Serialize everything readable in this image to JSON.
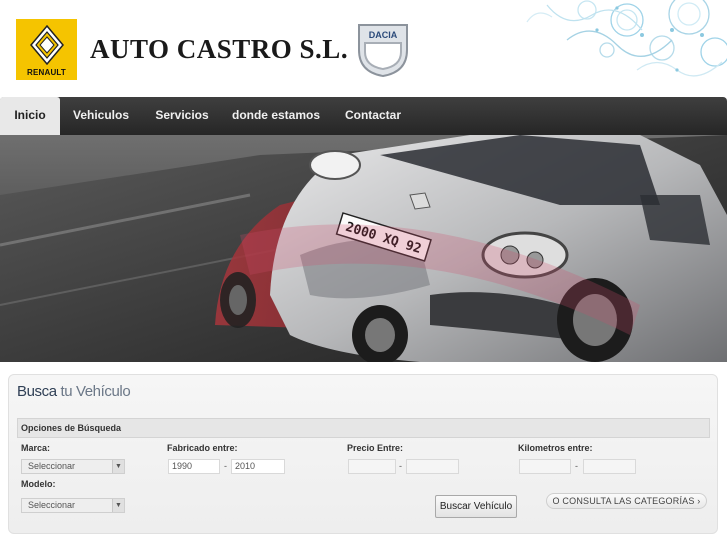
{
  "header": {
    "brand_left": "RENAULT",
    "site_title": "AUTO CASTRO S.L.",
    "brand_right": "DACIA"
  },
  "nav": {
    "items": [
      {
        "label": "Inicio",
        "active": true
      },
      {
        "label": "Vehiculos",
        "active": false
      },
      {
        "label": "Servicios",
        "active": false
      },
      {
        "label": "donde estamos",
        "active": false
      },
      {
        "label": "Contactar",
        "active": false
      }
    ]
  },
  "banner": {
    "plate_text": "2000 XQ 92"
  },
  "search": {
    "title_part1": "Busca",
    "title_part2": " tu Vehículo",
    "options_label": "Opciones de Búsqueda",
    "marca_label": "Marca:",
    "marca_value": "Seleccionar",
    "fabricado_label": "Fabricado entre:",
    "fabricado_from": "1990",
    "fabricado_to": "2010",
    "precio_label": "Precio Entre:",
    "precio_from": "",
    "precio_to": "",
    "km_label": "Kilometros entre:",
    "km_from": "",
    "km_to": "",
    "modelo_label": "Modelo:",
    "modelo_value": "Seleccionar",
    "dash": "-",
    "search_button": "Buscar Vehículo",
    "categories_button": "O CONSULTA LAS CATEGORÍAS",
    "categories_icon": "chevron-right-icon"
  },
  "colors": {
    "renault_yellow": "#f5c400",
    "nav_dark": "#2f2f2f",
    "title_dark": "#2f3f55",
    "title_light": "#6b7787"
  }
}
